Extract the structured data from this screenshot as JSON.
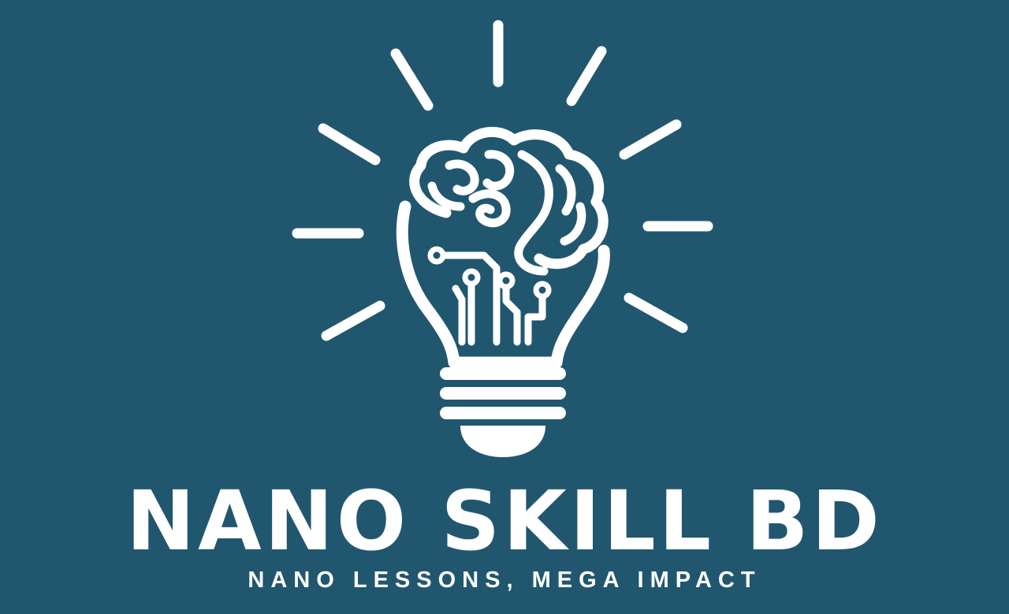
{
  "brand": {
    "name": "NANO SKILL BD",
    "tagline": "NANO LESSONS, MEGA IMPACT"
  },
  "logo": {
    "icon": "lightbulb-brain-circuit-icon"
  },
  "colors": {
    "background": "#21566f",
    "foreground": "#ffffff"
  }
}
